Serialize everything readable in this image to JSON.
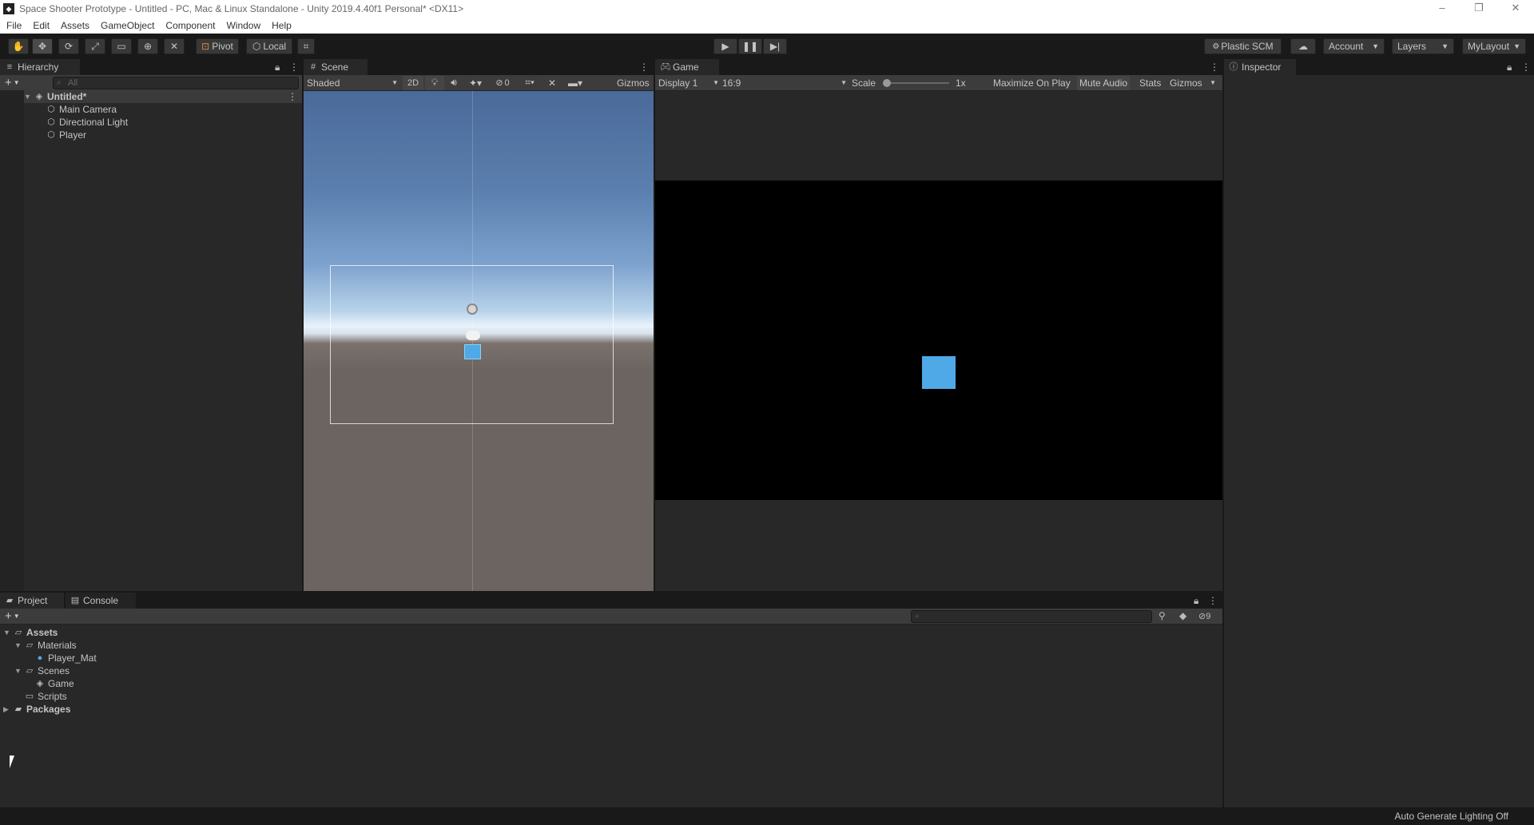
{
  "window": {
    "title": "Space Shooter Prototype - Untitled - PC, Mac & Linux Standalone - Unity 2019.4.40f1 Personal* <DX11>",
    "minimize": "–",
    "restore": "❐",
    "close": "✕"
  },
  "menu": [
    "File",
    "Edit",
    "Assets",
    "GameObject",
    "Component",
    "Window",
    "Help"
  ],
  "toolbar": {
    "pivot": "Pivot",
    "local": "Local",
    "plastic_scm": "Plastic SCM",
    "account": "Account",
    "layers": "Layers",
    "layout": "MyLayout"
  },
  "hierarchy": {
    "tab": "Hierarchy",
    "search_placeholder": "All",
    "scene": "Untitled*",
    "items": [
      "Main Camera",
      "Directional Light",
      "Player"
    ]
  },
  "scene_view": {
    "tab": "Scene",
    "shading": "Shaded",
    "mode_2d": "2D",
    "hidden_count": "0",
    "gizmos": "Gizmos"
  },
  "game_view": {
    "tab": "Game",
    "display": "Display 1",
    "aspect": "16:9",
    "scale_label": "Scale",
    "scale_value": "1x",
    "maximize": "Maximize On Play",
    "mute": "Mute Audio",
    "stats": "Stats",
    "gizmos": "Gizmos"
  },
  "inspector": {
    "tab": "Inspector"
  },
  "project": {
    "tab": "Project",
    "console_tab": "Console",
    "hidden_packages": "9",
    "tree": {
      "assets": "Assets",
      "materials": "Materials",
      "player_mat": "Player_Mat",
      "scenes": "Scenes",
      "game": "Game",
      "scripts": "Scripts",
      "packages": "Packages"
    }
  },
  "status": {
    "lighting": "Auto Generate Lighting Off"
  },
  "colors": {
    "player_cube": "#4fa9e6",
    "sky_top": "#4a6a9a",
    "ground": "#6b6461"
  }
}
